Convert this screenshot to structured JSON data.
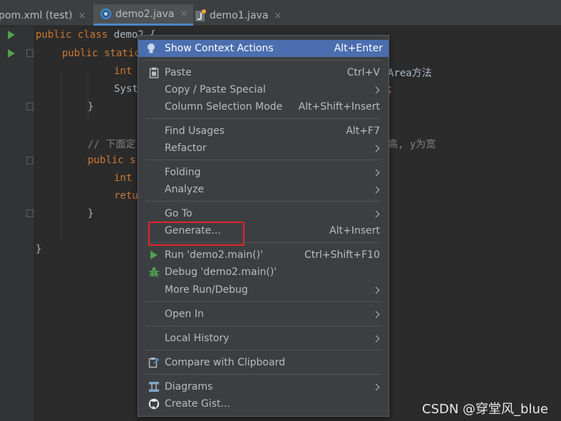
{
  "tabs": [
    {
      "label": "pom.xml (test)",
      "close": "×"
    },
    {
      "label": "demo2.java",
      "close": "×"
    },
    {
      "label": "demo1.java",
      "close": "×"
    }
  ],
  "code": {
    "l1a": "public class ",
    "l1b": "demo2 {",
    "l2a": "public static",
    "l3a": "int",
    "l3tail": "Area方法",
    "l4a": "Syst",
    "l4tail": ";",
    "l5": "}",
    "l7": "// 下面定",
    "l7tail": "高, y为宽",
    "l8a": "public s",
    "l9a": "int",
    "l10a": "retu",
    "l11": "}",
    "l13": "}"
  },
  "menu": {
    "show_context_actions": {
      "label": "Show Context Actions",
      "shortcut": "Alt+Enter"
    },
    "paste": {
      "label": "Paste",
      "shortcut": "Ctrl+V"
    },
    "copy_paste_special": {
      "label": "Copy / Paste Special"
    },
    "column_selection_mode": {
      "label": "Column Selection Mode",
      "shortcut": "Alt+Shift+Insert"
    },
    "find_usages": {
      "label": "Find Usages",
      "shortcut": "Alt+F7"
    },
    "refactor": {
      "label": "Refactor"
    },
    "folding": {
      "label": "Folding"
    },
    "analyze": {
      "label": "Analyze"
    },
    "go_to": {
      "label": "Go To"
    },
    "generate": {
      "label": "Generate...",
      "shortcut": "Alt+Insert"
    },
    "run": {
      "label": "Run 'demo2.main()'",
      "shortcut": "Ctrl+Shift+F10"
    },
    "debug": {
      "label": "Debug 'demo2.main()'"
    },
    "more_run_debug": {
      "label": "More Run/Debug"
    },
    "open_in": {
      "label": "Open In"
    },
    "local_history": {
      "label": "Local History"
    },
    "compare_clipboard": {
      "label": "Compare with Clipboard"
    },
    "diagrams": {
      "label": "Diagrams"
    },
    "create_gist": {
      "label": "Create Gist..."
    }
  },
  "watermark": "CSDN @穿堂风_blue",
  "colors": {
    "selection": "#4b6eaf",
    "highlight_box": "#e3262b",
    "run_green": "#4fa14f",
    "keyword": "#cc7832"
  }
}
